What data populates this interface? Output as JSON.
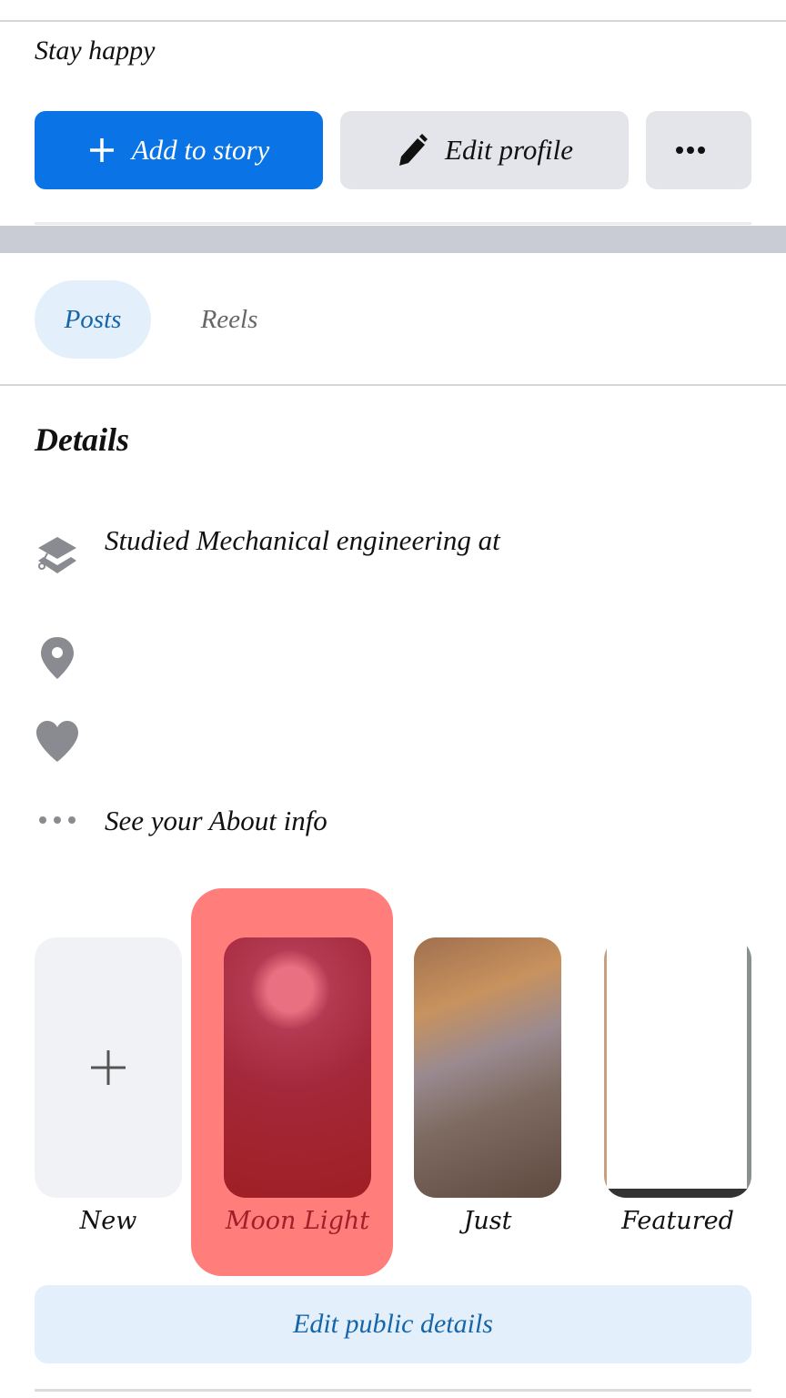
{
  "profile": {
    "bio": "Stay happy"
  },
  "actions": {
    "add_to_story": "Add to story",
    "edit_profile": "Edit profile",
    "more": "•••"
  },
  "tabs": [
    {
      "label": "Posts",
      "active": true
    },
    {
      "label": "Reels",
      "active": false
    }
  ],
  "details": {
    "title": "Details",
    "items": [
      {
        "icon": "graduation-cap-icon",
        "text": "Studied Mechanical engineering at"
      },
      {
        "icon": "location-pin-icon",
        "text": ""
      },
      {
        "icon": "heart-icon",
        "text": ""
      },
      {
        "icon": "more-dots-icon",
        "text": "See your About info"
      }
    ]
  },
  "highlights": [
    {
      "label": "New",
      "type": "add"
    },
    {
      "label": "Moon Light",
      "type": "image",
      "highlighted": true
    },
    {
      "label": "Just",
      "type": "image"
    },
    {
      "label": "Featured",
      "type": "image"
    }
  ],
  "edit_public_details": "Edit public details",
  "colors": {
    "primary": "#0a74e6",
    "secondary_button": "#e4e5ea",
    "tab_active_bg": "#e3f0fc",
    "tab_active_text": "#1665a8",
    "highlight": "#ff7d7b",
    "icon_gray": "#8a8b90"
  }
}
